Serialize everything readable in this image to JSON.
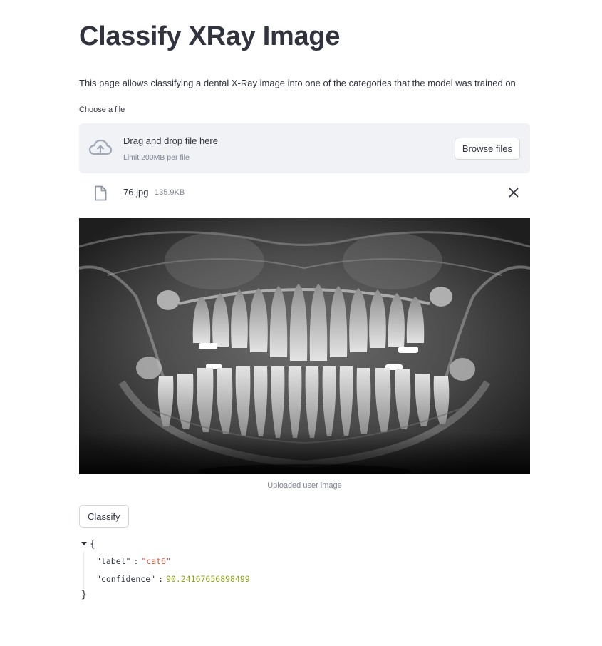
{
  "page": {
    "title": "Classify XRay Image",
    "description": "This page allows classifying a dental X-Ray image into one of the categories that the model was trained on"
  },
  "uploader": {
    "label": "Choose a file",
    "drop_text": "Drag and drop file here",
    "limit_text": "Limit 200MB per file",
    "browse_label": "Browse files",
    "upload_icon": "cloud-upload-icon"
  },
  "uploaded_file": {
    "name": "76.jpg",
    "size": "135.9KB",
    "file_icon": "file-icon",
    "remove_icon": "close-icon"
  },
  "image": {
    "caption": "Uploaded user image"
  },
  "actions": {
    "classify_label": "Classify"
  },
  "result": {
    "open_brace": "{",
    "close_brace": "}",
    "label_key": "\"label\"",
    "label_value": "\"cat6\"",
    "confidence_key": "\"confidence\"",
    "confidence_value": "90.24167656898499",
    "colon": ":"
  },
  "colors": {
    "text": "#31333f",
    "muted": "#808495",
    "dropzone_bg": "#f0f2f6",
    "json_string": "#c8553d",
    "json_number": "#8aa51e"
  }
}
